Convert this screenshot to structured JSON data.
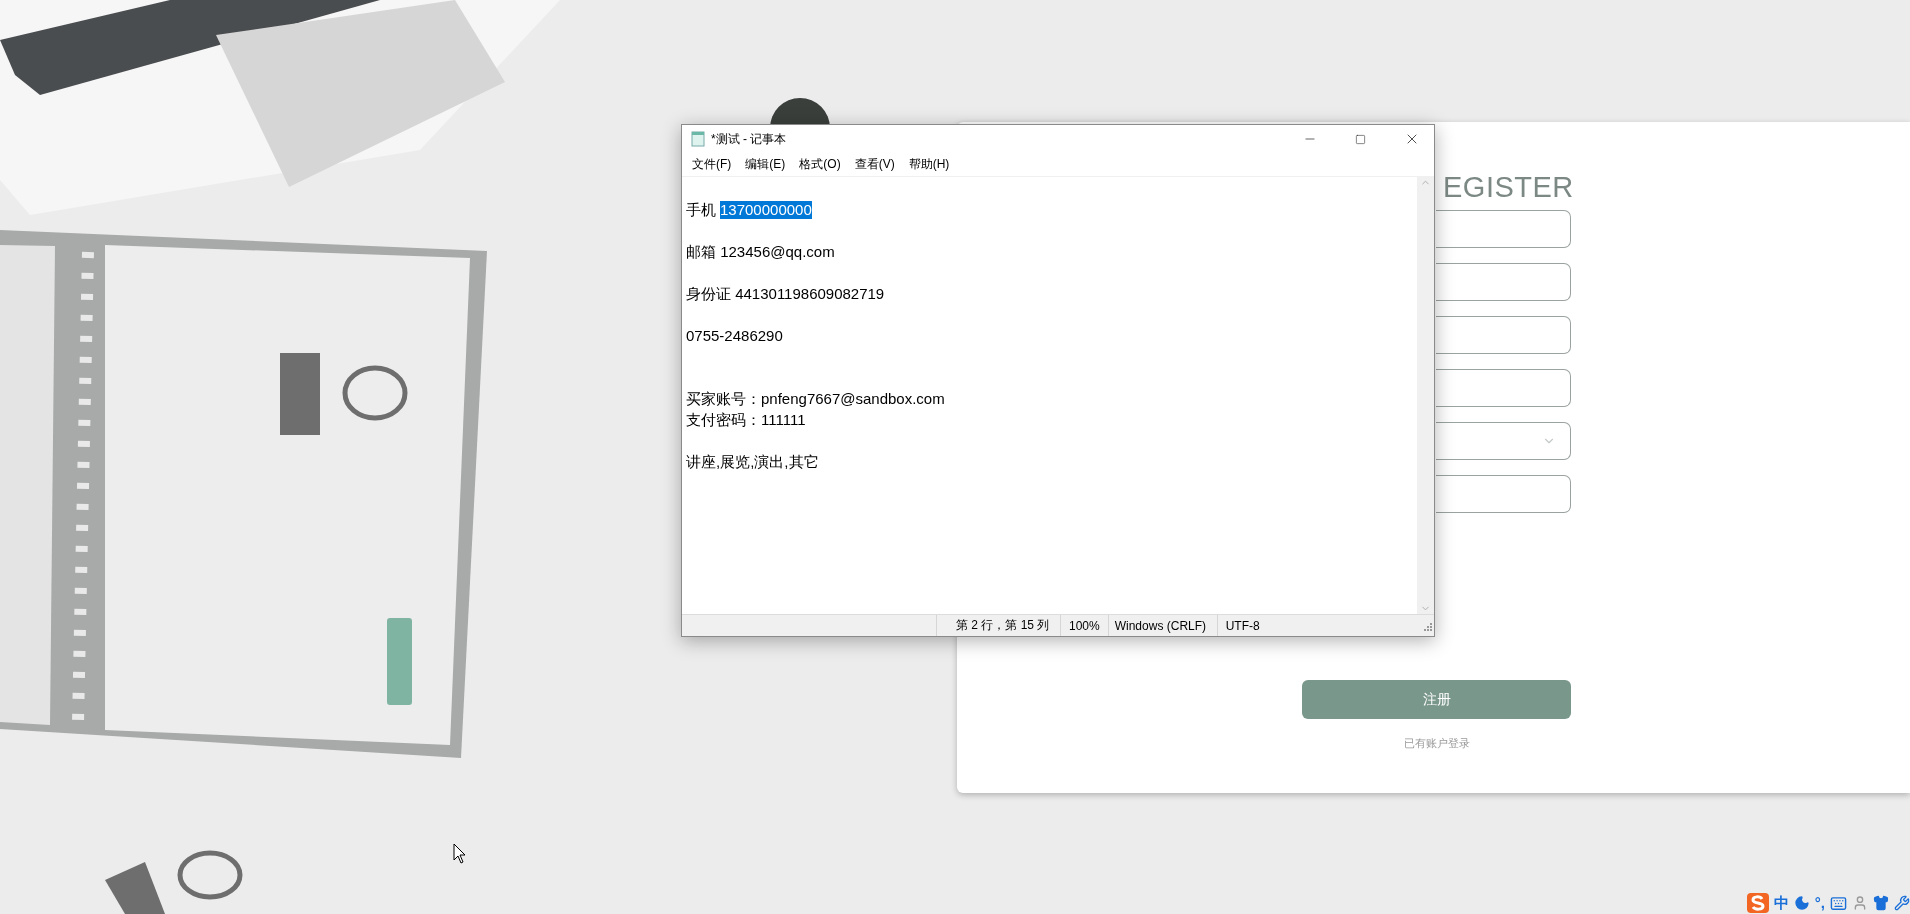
{
  "notepad": {
    "title": "*测试 - 记事本",
    "menu": [
      "文件(F)",
      "编辑(E)",
      "格式(O)",
      "查看(V)",
      "帮助(H)"
    ],
    "paragraphs": [
      {
        "kind": "plain",
        "lines": [
          {
            "parts": [
              {
                "text": "手机",
                "selected": false
              },
              {
                "text": "13700000000",
                "selected": true
              }
            ]
          }
        ]
      },
      {
        "kind": "plain",
        "lines": [
          {
            "parts": [
              {
                "text": "邮箱 123456@qq.com",
                "selected": false
              }
            ]
          }
        ]
      },
      {
        "kind": "plain",
        "lines": [
          {
            "parts": [
              {
                "text": "身份证 441301198609082719",
                "selected": false
              }
            ]
          }
        ]
      },
      {
        "kind": "plain",
        "lines": [
          {
            "parts": [
              {
                "text": "0755-2486290",
                "selected": false
              }
            ]
          }
        ]
      },
      {
        "kind": "spaced",
        "lines": [
          {
            "parts": [
              {
                "text": "买家账号：pnfeng7667@sandbox.com",
                "selected": false
              }
            ]
          },
          {
            "parts": [
              {
                "text": "支付密码：111111",
                "selected": false
              }
            ]
          }
        ]
      },
      {
        "kind": "plain",
        "lines": [
          {
            "parts": [
              {
                "text": "讲座,展览,演出,其它",
                "selected": false
              }
            ]
          }
        ]
      }
    ],
    "status": {
      "position": "第 2 行，第 15 列",
      "zoom": "100%",
      "line_ending": "Windows (CRLF)",
      "encoding": "UTF-8"
    }
  },
  "register": {
    "title": "EGISTER",
    "fields": [
      {
        "kind": "input"
      },
      {
        "kind": "input"
      },
      {
        "kind": "input"
      },
      {
        "kind": "input"
      },
      {
        "kind": "select"
      },
      {
        "kind": "input"
      }
    ],
    "submit": "注册",
    "login_link": "已有账户登录"
  },
  "tray": {
    "ime": "中",
    "punctuation": "°,"
  }
}
